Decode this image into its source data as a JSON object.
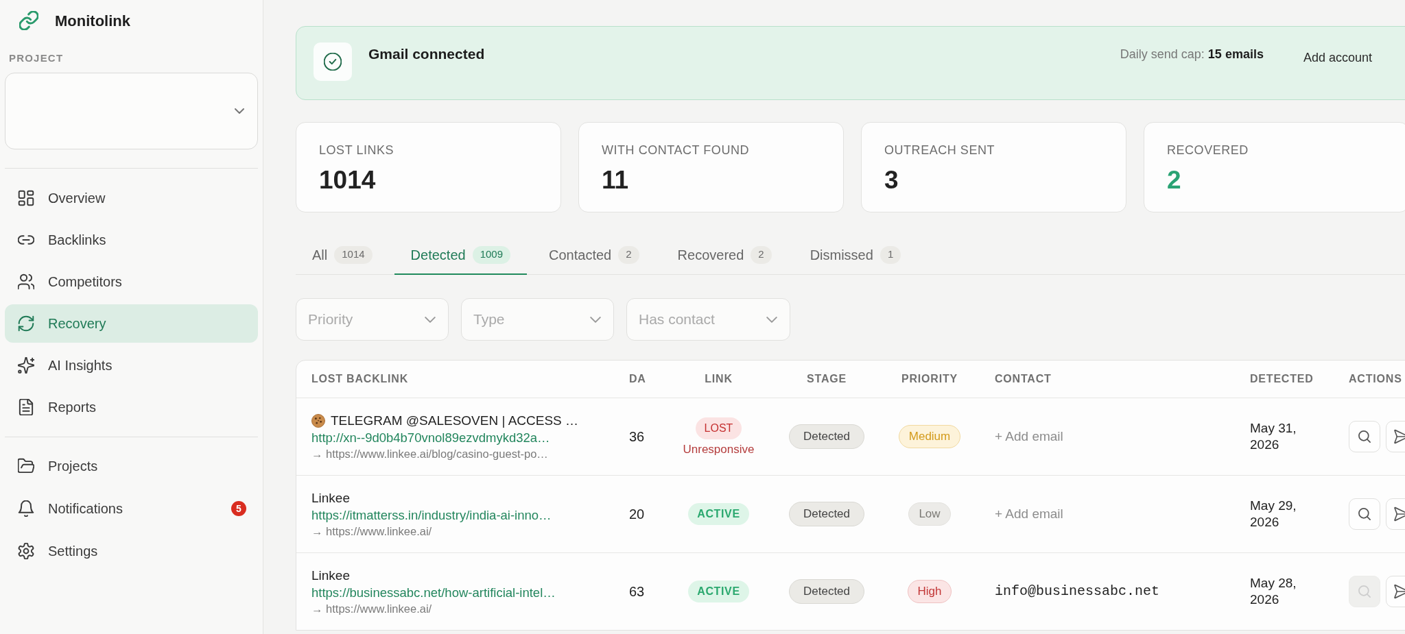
{
  "sidebar": {
    "app_name": "Monitolink",
    "project_label": "PROJECT",
    "nav_sections": [
      {
        "items": [
          {
            "label": "Overview",
            "selected": false
          },
          {
            "label": "Backlinks",
            "selected": false
          },
          {
            "label": "Competitors",
            "selected": false
          },
          {
            "label": "Recovery",
            "selected": true
          },
          {
            "label": "AI Insights",
            "selected": false
          },
          {
            "label": "Reports",
            "selected": false
          }
        ]
      },
      {
        "items": [
          {
            "label": "Projects",
            "selected": false
          },
          {
            "label": "Notifications",
            "selected": false,
            "badge": "5"
          },
          {
            "label": "Settings",
            "selected": false
          }
        ]
      }
    ]
  },
  "banner": {
    "title": "Gmail connected",
    "send_cap": "Daily send cap: **15 emails**",
    "action": "Add account"
  },
  "stats": [
    {
      "label": "LOST LINKS",
      "value": "1014",
      "highlight": false
    },
    {
      "label": "WITH CONTACT FOUND",
      "value": "11",
      "highlight": false
    },
    {
      "label": "OUTREACH SENT",
      "value": "3",
      "highlight": false
    },
    {
      "label": "RECOVERED",
      "value": "2",
      "highlight": true
    }
  ],
  "tabs": [
    {
      "label": "All",
      "count": "1014",
      "selected": false
    },
    {
      "label": "Detected",
      "count": "1009",
      "selected": true
    },
    {
      "label": "Contacted",
      "count": "2",
      "selected": false
    },
    {
      "label": "Recovered",
      "count": "2",
      "selected": false
    },
    {
      "label": "Dismissed",
      "count": "1",
      "selected": false
    }
  ],
  "filters": [
    {
      "placeholder": "Priority"
    },
    {
      "placeholder": "Type"
    },
    {
      "placeholder": "Has contact"
    }
  ],
  "table": {
    "columns": [
      "LOST BACKLINK",
      "DA",
      "LINK",
      "STAGE",
      "PRIORITY",
      "CONTACT",
      "DETECTED",
      "ACTIONS"
    ],
    "rows": [
      {
        "title_icon": true,
        "title": "TELEGRAM @SALESOVEN | ACCESS …",
        "url": "http://xn--9d0b4b70vnol89ezvdmykd32a…",
        "target": "→ https://www.linkee.ai/blog/casino-guest-po…",
        "da": "36",
        "link": {
          "label": "LOST",
          "kind": "lost",
          "note": "Unresponsive"
        },
        "stage": "Detected",
        "priority": {
          "label": "Medium",
          "kind": "medium"
        },
        "contact": {
          "kind": "add",
          "text": "+ Add email"
        },
        "detected": "May 31, 2026",
        "actions": [
          {
            "kind": "search",
            "disabled": false
          },
          {
            "kind": "send",
            "disabled": false
          }
        ]
      },
      {
        "title_icon": false,
        "title": "Linkee",
        "url": "https://itmatterss.in/industry/india-ai-inno…",
        "target": "→ https://www.linkee.ai/",
        "da": "20",
        "link": {
          "label": "ACTIVE",
          "kind": "active"
        },
        "stage": "Detected",
        "priority": {
          "label": "Low",
          "kind": "low"
        },
        "contact": {
          "kind": "add",
          "text": "+ Add email"
        },
        "detected": "May 29, 2026",
        "actions": [
          {
            "kind": "search",
            "disabled": false
          },
          {
            "kind": "send",
            "disabled": false
          }
        ]
      },
      {
        "title_icon": false,
        "title": "Linkee",
        "url": "https://businessabc.net/how-artificial-intel…",
        "target": "→ https://www.linkee.ai/",
        "da": "63",
        "link": {
          "label": "ACTIVE",
          "kind": "active"
        },
        "stage": "Detected",
        "priority": {
          "label": "High",
          "kind": "high"
        },
        "contact": {
          "kind": "email",
          "text": "info@businessabc.net"
        },
        "detected": "May 28, 2026",
        "actions": [
          {
            "kind": "search",
            "disabled": true
          },
          {
            "kind": "send",
            "disabled": false
          }
        ]
      }
    ]
  }
}
